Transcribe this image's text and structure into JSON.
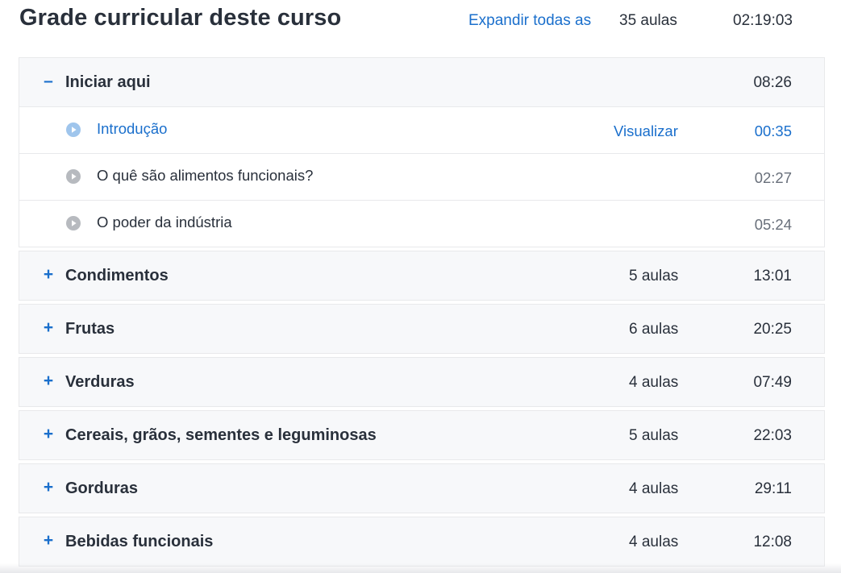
{
  "header": {
    "title": "Grade curricular deste curso",
    "expand_all": "Expandir todas as",
    "total_lectures": "35 aulas",
    "total_time": "02:19:03"
  },
  "colors": {
    "accent": "#1a6fcc",
    "text": "#29303b",
    "muted": "#686f7a",
    "section_bg": "#f7f8fa"
  },
  "sections": [
    {
      "toggle": "–",
      "title": "Iniciar aqui",
      "count": "",
      "time": "08:26",
      "expanded": true,
      "lectures": [
        {
          "title": "Introdução",
          "preview": "Visualizar",
          "time": "00:35",
          "icon": "play-circle-icon"
        },
        {
          "title": "O quê são alimentos funcionais?",
          "preview": "",
          "time": "02:27",
          "icon": "play-circle-icon"
        },
        {
          "title": "O poder da indústria",
          "preview": "",
          "time": "05:24",
          "icon": "play-circle-icon"
        }
      ]
    },
    {
      "toggle": "+",
      "title": "Condimentos",
      "count": "5 aulas",
      "time": "13:01"
    },
    {
      "toggle": "+",
      "title": "Frutas",
      "count": "6 aulas",
      "time": "20:25"
    },
    {
      "toggle": "+",
      "title": "Verduras",
      "count": "4 aulas",
      "time": "07:49"
    },
    {
      "toggle": "+",
      "title": "Cereais, grãos, sementes e leguminosas",
      "count": "5 aulas",
      "time": "22:03"
    },
    {
      "toggle": "+",
      "title": "Gorduras",
      "count": "4 aulas",
      "time": "29:11"
    },
    {
      "toggle": "+",
      "title": "Bebidas funcionais",
      "count": "4 aulas",
      "time": "12:08"
    }
  ]
}
